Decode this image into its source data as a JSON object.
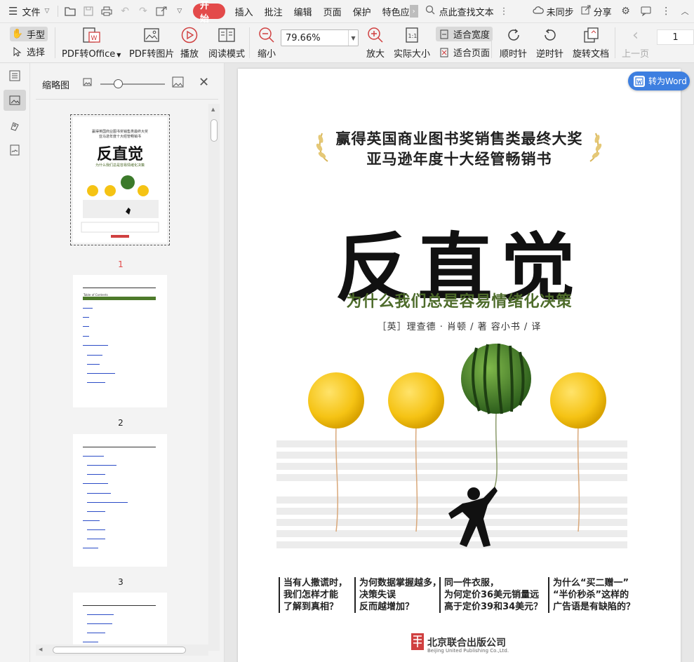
{
  "menu": {
    "file": "文件",
    "tabs": [
      "开始",
      "插入",
      "批注",
      "编辑",
      "页面",
      "保护",
      "特色应"
    ],
    "search_placeholder": "点此查找文本",
    "sync": "未同步",
    "share": "分享"
  },
  "ribbon": {
    "hand": "手型",
    "select": "选择",
    "pdf_to_office": "PDF转Office",
    "pdf_to_image": "PDF转图片",
    "play": "播放",
    "read_mode": "阅读模式",
    "zoom_out": "缩小",
    "zoom_value": "79.66%",
    "zoom_in": "放大",
    "actual_size": "实际大小",
    "fit_width": "适合宽度",
    "fit_page": "适合页面",
    "rotate_cw": "顺时针",
    "rotate_ccw": "逆时针",
    "rotate_doc": "旋转文档",
    "prev_page": "上一页",
    "page_number": "1",
    "actual_size_icon_text": "1:1"
  },
  "thumbnails": {
    "title": "缩略图",
    "pages": [
      "1",
      "2",
      "3"
    ],
    "thumb1_award": "赢得英国商业图书奖销售类最终大奖",
    "thumb1_award2": "亚马逊年度十大经管畅销书",
    "thumb1_title": "反直觉",
    "thumb1_subtitle": "为什么我们总是容易情绪化决策",
    "thumb2_heading": "Table of Contents"
  },
  "document": {
    "to_word": "转为Word",
    "award_line1": "赢得英国商业图书奖销售类最终大奖",
    "award_line2": "亚马逊年度十大经管畅销书",
    "title": "反直觉",
    "subtitle": "为什么我们总是容易情绪化决策",
    "authors": "［英］理查德 · 肖顿 / 著   容小书 / 译",
    "questions": [
      [
        "当有人撒谎时，",
        "我们怎样才能",
        "了解到真相？"
      ],
      [
        "为何数据掌握越多，",
        "决策失误",
        "反而越增加？"
      ],
      [
        "同一件衣服，",
        "为何定价36美元销量远",
        "高于定价39和34美元？"
      ],
      [
        "为什么“买二赠一”",
        "“半价秒杀”这样的",
        "广告语是有缺陷的？"
      ]
    ],
    "publisher": "北京联合出版公司",
    "publisher_en": "Beijing United Publishing Co.,Ltd."
  },
  "colors": {
    "accent_red": "#e34a4a",
    "word_blue": "#3d7fe0",
    "subtitle_green": "#4d6b2a",
    "balloon_yellow": "#f5c314"
  }
}
